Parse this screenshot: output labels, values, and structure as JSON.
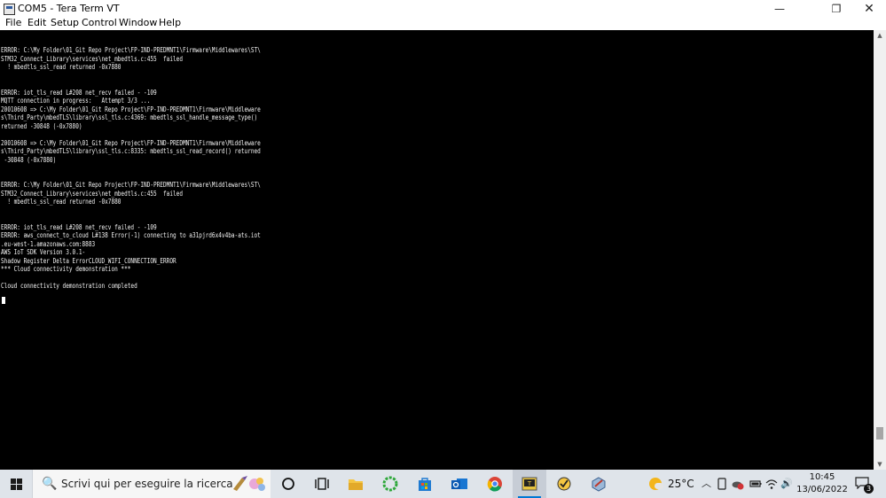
{
  "window": {
    "title": "COM5 - Tera Term VT",
    "controls": {
      "minimize": "—",
      "maximize": "❐",
      "close": "✕"
    }
  },
  "menu": [
    "File",
    "Edit",
    "Setup",
    "Control",
    "Window",
    "Help"
  ],
  "terminal": {
    "lines": [
      "ERROR: C:\\My Folder\\01_Git Repo Project\\FP-IND-PREDMNT1\\Firmware\\Middlewares\\ST\\",
      "STM32_Connect_Library\\services\\net_mbedtls.c:455  failed",
      "  ! mbedtls_ssl_read returned -0x7880",
      "",
      "",
      "ERROR: iot_tls_read L#208 net_recv failed - -109",
      "MQTT connection in progress:   Attempt 3/3 ...",
      "20010608 => C:\\My Folder\\01_Git Repo Project\\FP-IND-PREDMNT1\\Firmware\\Middleware",
      "s\\Third_Party\\mbedTLS\\library\\ssl_tls.c:4369: mbedtls_ssl_handle_message_type()",
      "returned -30848 (-0x7880)",
      "",
      "20010608 => C:\\My Folder\\01_Git Repo Project\\FP-IND-PREDMNT1\\Firmware\\Middleware",
      "s\\Third_Party\\mbedTLS\\library\\ssl_tls.c:8335: mbedtls_ssl_read_record() returned",
      " -30848 (-0x7880)",
      "",
      "",
      "ERROR: C:\\My Folder\\01_Git Repo Project\\FP-IND-PREDMNT1\\Firmware\\Middlewares\\ST\\",
      "STM32_Connect_Library\\services\\net_mbedtls.c:455  failed",
      "  ! mbedtls_ssl_read returned -0x7880",
      "",
      "",
      "ERROR: iot_tls_read L#208 net_recv failed - -109",
      "ERROR: aws_connect_to_cloud L#138 Error(-1) connecting to a31pjrd6x4v4ba-ats.iot",
      ".eu-west-1.amazonaws.com:8883",
      "AWS IoT SDK Version 3.0.1-",
      "Shadow Register Delta ErrorCLOUD_WIFI_CONNECTION_ERROR",
      "*** Cloud connectivity demonstration ***",
      "",
      "Cloud connectivity demonstration completed"
    ]
  },
  "scrollbar": {
    "up": "▲",
    "down": "▼"
  },
  "taskbar": {
    "search_icon": "🔍",
    "search_placeholder": "Scrivi qui per eseguire la ricerca",
    "weather_temp": "25°C",
    "tray": {
      "chevron": "︿",
      "speaker": "🔊"
    },
    "time": "10:45",
    "date": "13/06/2022",
    "notification_count": "3",
    "colors": {
      "active_indicator": "#0078d4",
      "taskbar_bg": "#dfe4ea",
      "terminal_bg": "#000000"
    }
  }
}
